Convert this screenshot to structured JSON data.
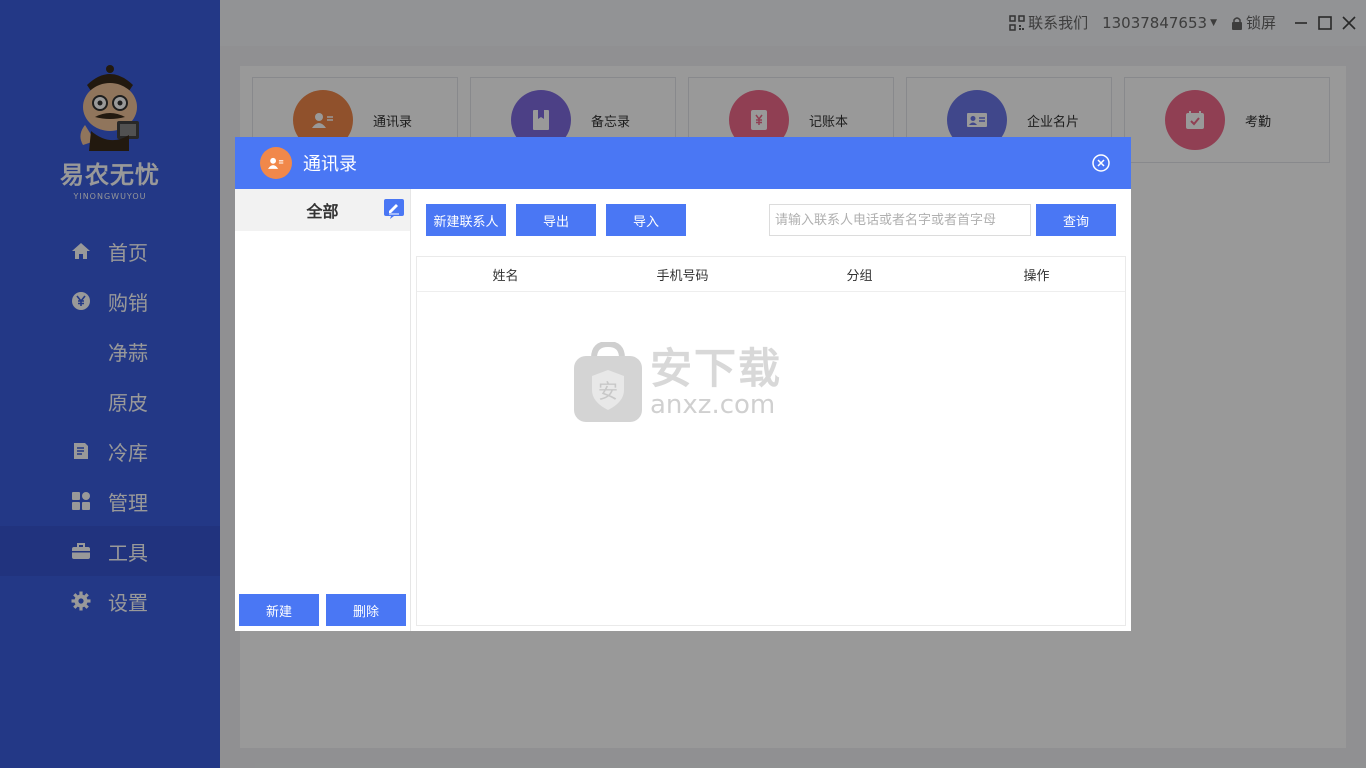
{
  "sidebar": {
    "brand": "易农无忧",
    "brand_sub": "YINONGWUYOU",
    "items": [
      {
        "label": "首页",
        "icon": "home-icon"
      },
      {
        "label": "购销",
        "icon": "yen-icon"
      },
      {
        "label": "净蒜",
        "icon": ""
      },
      {
        "label": "原皮",
        "icon": ""
      },
      {
        "label": "冷库",
        "icon": "document-icon"
      },
      {
        "label": "管理",
        "icon": "grid-icon"
      },
      {
        "label": "工具",
        "icon": "toolbox-icon",
        "active": true
      },
      {
        "label": "设置",
        "icon": "gear-icon"
      }
    ]
  },
  "topbar": {
    "contact": "联系我们",
    "phone": "13037847653",
    "lock": "锁屏"
  },
  "tools": [
    {
      "label": "通讯录",
      "color": "#f1884a"
    },
    {
      "label": "备忘录",
      "color": "#7f6ce0"
    },
    {
      "label": "记账本",
      "color": "#f06a8a"
    },
    {
      "label": "企业名片",
      "color": "#6c77e8"
    },
    {
      "label": "考勤",
      "color": "#f06a8a"
    }
  ],
  "modal": {
    "title": "通讯录",
    "group_all": "全部",
    "new_group": "新建",
    "delete_group": "删除",
    "new_contact": "新建联系人",
    "export": "导出",
    "import": "导入",
    "search_placeholder": "请输入联系人电话或者名字或者首字母",
    "query": "查询",
    "columns": [
      "姓名",
      "手机号码",
      "分组",
      "操作"
    ]
  },
  "watermark": {
    "cn": "安下载",
    "en": "anxz.com",
    "badge": "安"
  },
  "colors": {
    "sidebar": "#3b5ee0",
    "primary": "#4a77f4"
  }
}
